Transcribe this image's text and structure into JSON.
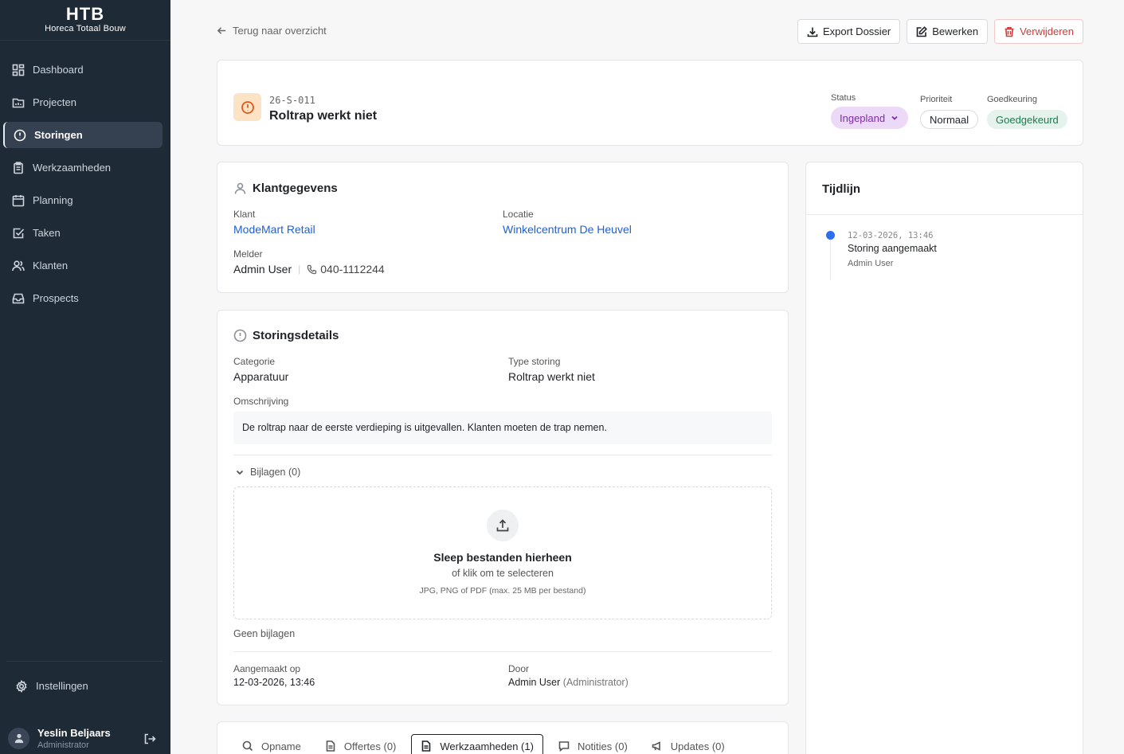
{
  "sidebar": {
    "logo_mark": "HTB",
    "logo_text": "Horeca Totaal Bouw",
    "items": [
      {
        "label": "Dashboard"
      },
      {
        "label": "Projecten"
      },
      {
        "label": "Storingen"
      },
      {
        "label": "Werkzaamheden"
      },
      {
        "label": "Planning"
      },
      {
        "label": "Taken"
      },
      {
        "label": "Klanten"
      },
      {
        "label": "Prospects"
      }
    ],
    "active_item": "Storingen",
    "settings_label": "Instellingen",
    "user": {
      "name": "Yeslin Beljaars",
      "role": "Administrator"
    }
  },
  "header": {
    "back_label": "Terug naar overzicht",
    "actions": {
      "export": "Export Dossier",
      "edit": "Bewerken",
      "delete": "Verwijderen"
    }
  },
  "ticket": {
    "number": "26-S-011",
    "title": "Roltrap werkt niet",
    "status_label": "Status",
    "status": "Ingepland",
    "priority_label": "Prioriteit",
    "priority": "Normaal",
    "approval_label": "Goedkeuring",
    "approval": "Goedgekeurd"
  },
  "klant": {
    "title": "Klantgegevens",
    "klant_label": "Klant",
    "klant": "ModeMart Retail",
    "locatie_label": "Locatie",
    "locatie": "Winkelcentrum De Heuvel",
    "melder_label": "Melder",
    "melder": "Admin User",
    "phone": "040-1112244"
  },
  "details": {
    "title": "Storingsdetails",
    "categorie_label": "Categorie",
    "categorie": "Apparatuur",
    "type_label": "Type storing",
    "type": "Roltrap werkt niet",
    "omschrijving_label": "Omschrijving",
    "omschrijving": "De roltrap naar de eerste verdieping is uitgevallen. Klanten moeten de trap nemen.",
    "bijlagen_label": "Bijlagen (0)",
    "dropzone": {
      "title": "Sleep bestanden hierheen",
      "sub": "of klik om te selecteren",
      "hint": "JPG, PNG of PDF (max. 25 MB per bestand)"
    },
    "geen_bijlagen": "Geen bijlagen",
    "aangemaakt_label": "Aangemaakt op",
    "aangemaakt": "12-03-2026, 13:46",
    "door_label": "Door",
    "door": "Admin User",
    "door_role": "(Administrator)"
  },
  "tabs": [
    {
      "label": "Opname"
    },
    {
      "label": "Offertes (0)"
    },
    {
      "label": "Werkzaamheden (1)"
    },
    {
      "label": "Notities (0)"
    },
    {
      "label": "Updates (0)"
    }
  ],
  "timeline": {
    "title": "Tijdlijn",
    "events": [
      {
        "time": "12-03-2026, 13:46",
        "title": "Storing aangemaakt",
        "user": "Admin User"
      }
    ]
  }
}
